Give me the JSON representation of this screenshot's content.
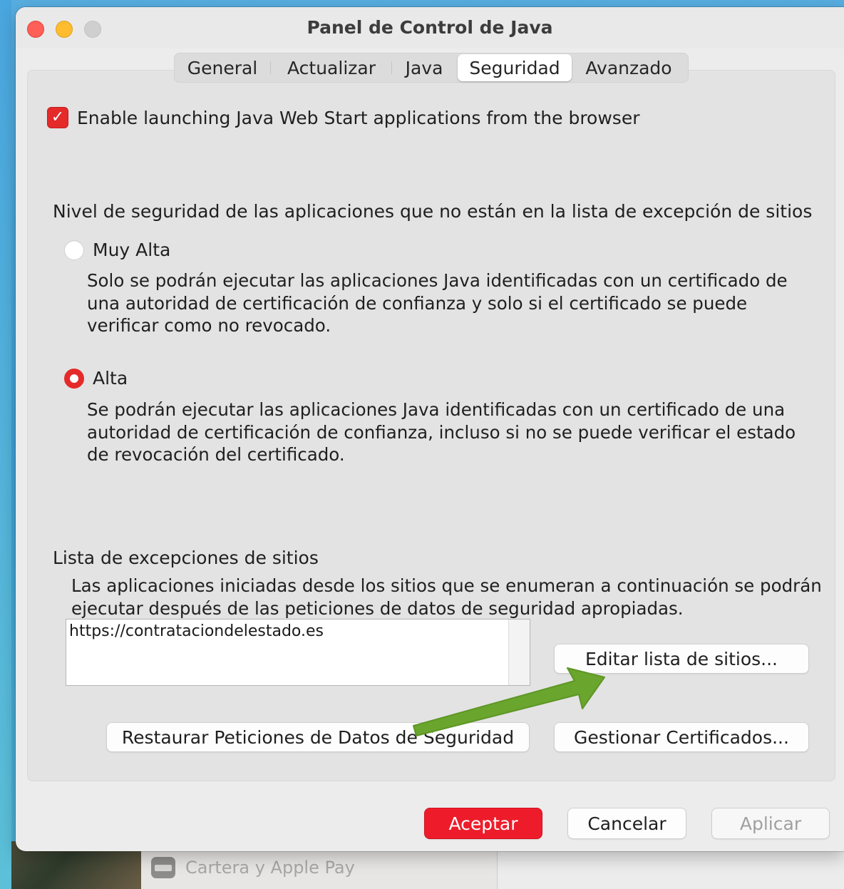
{
  "window": {
    "title": "Panel de Control de Java"
  },
  "tabs": [
    {
      "label": "General",
      "active": false
    },
    {
      "label": "Actualizar",
      "active": false
    },
    {
      "label": "Java",
      "active": false
    },
    {
      "label": "Seguridad",
      "active": true
    },
    {
      "label": "Avanzado",
      "active": false
    }
  ],
  "security": {
    "web_start_checkbox": {
      "label": "Enable launching Java Web Start applications from the browser",
      "checked": true
    },
    "level_title": "Nivel de seguridad de las aplicaciones que no están en la lista de excepción de sitios",
    "levels": [
      {
        "label": "Muy Alta",
        "selected": false,
        "description": "Solo se podrán ejecutar las aplicaciones Java identificadas con un certificado de una autoridad de certificación de confianza y solo si el certificado se puede verificar como no revocado."
      },
      {
        "label": "Alta",
        "selected": true,
        "description": "Se podrán ejecutar las aplicaciones Java identificadas con un certificado de una autoridad de certificación de confianza, incluso si no se puede verificar el estado de revocación del certificado."
      }
    ],
    "exceptions": {
      "title": "Lista de excepciones de sitios",
      "description": "Las aplicaciones iniciadas desde los sitios que se enumeran a continuación se podrán ejecutar después de las peticiones de datos de seguridad apropiadas.",
      "sites": [
        "https://contrataciondelestado.es"
      ],
      "edit_button": "Editar lista de sitios..."
    },
    "restore_button": "Restaurar Peticiones de Datos de Seguridad",
    "certificates_button": "Gestionar Certificados..."
  },
  "footer": {
    "accept": "Aceptar",
    "cancel": "Cancelar",
    "apply": "Aplicar"
  },
  "background": {
    "wallet_item": "Cartera y Apple Pay"
  },
  "colors": {
    "accent": "#ee1c2b",
    "annotation_arrow": "#6aa52d"
  }
}
